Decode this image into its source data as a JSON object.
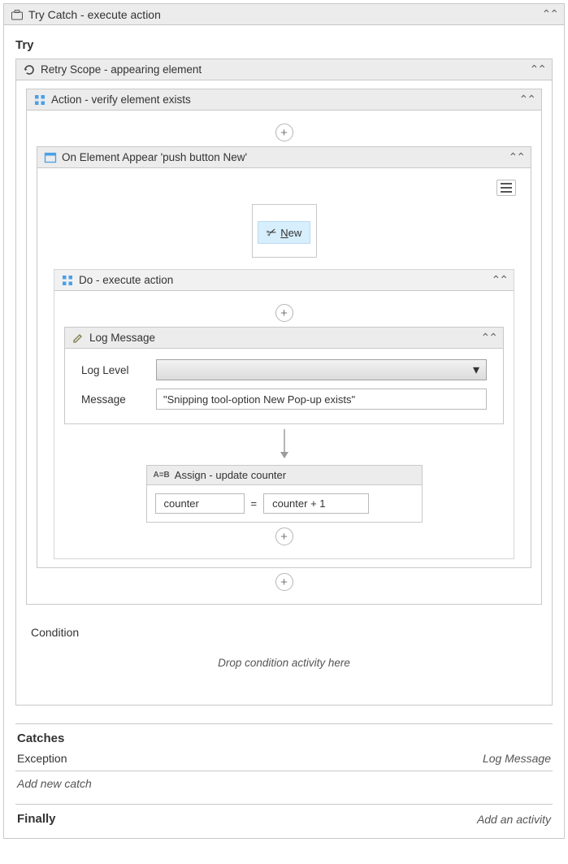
{
  "tryCatch": {
    "title": "Try Catch - execute action",
    "tryLabel": "Try",
    "retryScope": {
      "title": "Retry Scope - appearing element",
      "action": {
        "title": "Action - verify element exists",
        "onElementAppear": {
          "title": "On Element Appear 'push button  New'",
          "previewLabel": "New",
          "do": {
            "title": "Do - execute action",
            "logMessage": {
              "title": "Log Message",
              "logLevelLabel": "Log Level",
              "logLevelValue": "",
              "messageLabel": "Message",
              "messageValue": "\"Snipping tool-option New Pop-up exists\""
            },
            "assign": {
              "title": "Assign - update counter",
              "left": "counter",
              "right": "counter + 1"
            }
          }
        }
      },
      "conditionLabel": "Condition",
      "conditionDropText": "Drop condition activity here"
    },
    "catchesLabel": "Catches",
    "exceptionLabel": "Exception",
    "exceptionHandler": "Log Message",
    "addNewCatch": "Add new catch",
    "finallyLabel": "Finally",
    "addActivity": "Add an activity"
  }
}
